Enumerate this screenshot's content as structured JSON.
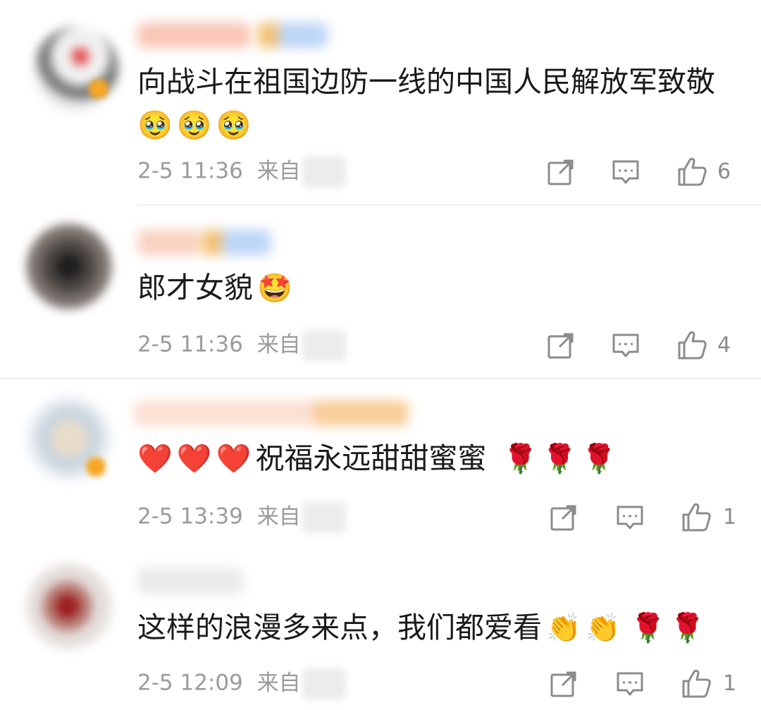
{
  "comments": [
    {
      "content": "向战斗在祖国边防一线的中国人民解放军致敬",
      "emojis": [
        "🥹",
        "🥹",
        "🥹"
      ],
      "time": "2-5 11:36",
      "source_prefix": "来自",
      "likes": "6",
      "avatar_icon": "blurred-avatar",
      "emoji_icon": "touched-face-emoji"
    },
    {
      "content": "郎才女貌",
      "emojis": [
        "🤩"
      ],
      "time": "2-5 11:36",
      "source_prefix": "来自",
      "likes": "4",
      "avatar_icon": "blurred-avatar",
      "emoji_icon": "star-struck-hug-emoji"
    },
    {
      "content_prefix_emojis": [
        "❤️",
        "❤️",
        "❤️"
      ],
      "content": "祝福永远甜甜蜜蜜",
      "emojis": [
        "🌹",
        "🌹",
        "🌹"
      ],
      "time": "2-5 13:39",
      "source_prefix": "来自",
      "likes": "1",
      "avatar_icon": "blurred-avatar",
      "emoji_icon": "heart-and-rose-emoji"
    },
    {
      "content": "这样的浪漫多来点，我们都爱看",
      "emojis": [
        "👏",
        "👏",
        "🌹",
        "🌹"
      ],
      "time": "2-5 12:09",
      "source_prefix": "来自",
      "likes": "1",
      "avatar_icon": "blurred-avatar",
      "emoji_icon": "clap-and-rose-emoji"
    }
  ],
  "colors": {
    "text": "#1a1a1a",
    "meta": "#9b9b9b",
    "icon": "#8c8c8c",
    "divider": "#e6e6e6"
  }
}
